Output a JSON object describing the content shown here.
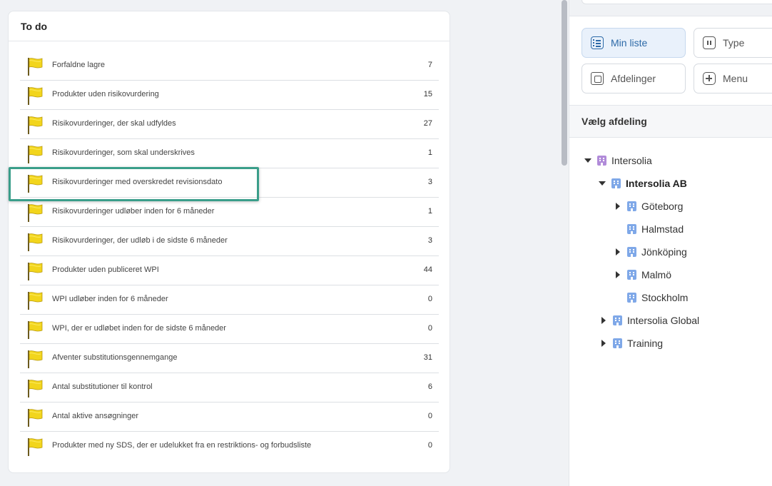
{
  "todo": {
    "title": "To do",
    "items": [
      {
        "label": "Forfaldne lagre",
        "count": "7"
      },
      {
        "label": "Produkter uden risikovurdering",
        "count": "15"
      },
      {
        "label": "Risikovurderinger, der skal udfyldes",
        "count": "27"
      },
      {
        "label": "Risikovurderinger, som skal underskrives",
        "count": "1"
      },
      {
        "label": "Risikovurderinger med overskredet revisionsdato",
        "count": "3"
      },
      {
        "label": "Risikovurderinger udløber inden for 6 måneder",
        "count": "1"
      },
      {
        "label": "Risikovurderinger, der udløb i de sidste 6 måneder",
        "count": "3"
      },
      {
        "label": "Produkter uden publiceret WPI",
        "count": "44"
      },
      {
        "label": "WPI udløber inden for 6 måneder",
        "count": "0"
      },
      {
        "label": "WPI, der er udløbet inden for de sidste 6 måneder",
        "count": "0"
      },
      {
        "label": "Afventer substitutionsgennemgange",
        "count": "31"
      },
      {
        "label": "Antal substitutioner til kontrol",
        "count": "6"
      },
      {
        "label": "Antal aktive ansøgninger",
        "count": "0"
      },
      {
        "label": "Produkter med ny SDS, der er udelukket fra en restriktions- og forbudsliste",
        "count": "0"
      }
    ],
    "flag_icon": "yellow-flag-icon",
    "highlight_color": "#3a9e8a"
  },
  "nav": {
    "min_liste": "Min liste",
    "type": "Type",
    "afdelinger": "Afdelinger",
    "menu": "Menu"
  },
  "departments": {
    "title": "Vælg afdeling",
    "tree": {
      "root": "Intersolia",
      "ab": "Intersolia AB",
      "goteborg": "Göteborg",
      "halmstad": "Halmstad",
      "jonkoping": "Jönköping",
      "malmo": "Malmö",
      "stockholm": "Stockholm",
      "global": "Intersolia Global",
      "training": "Training"
    }
  }
}
